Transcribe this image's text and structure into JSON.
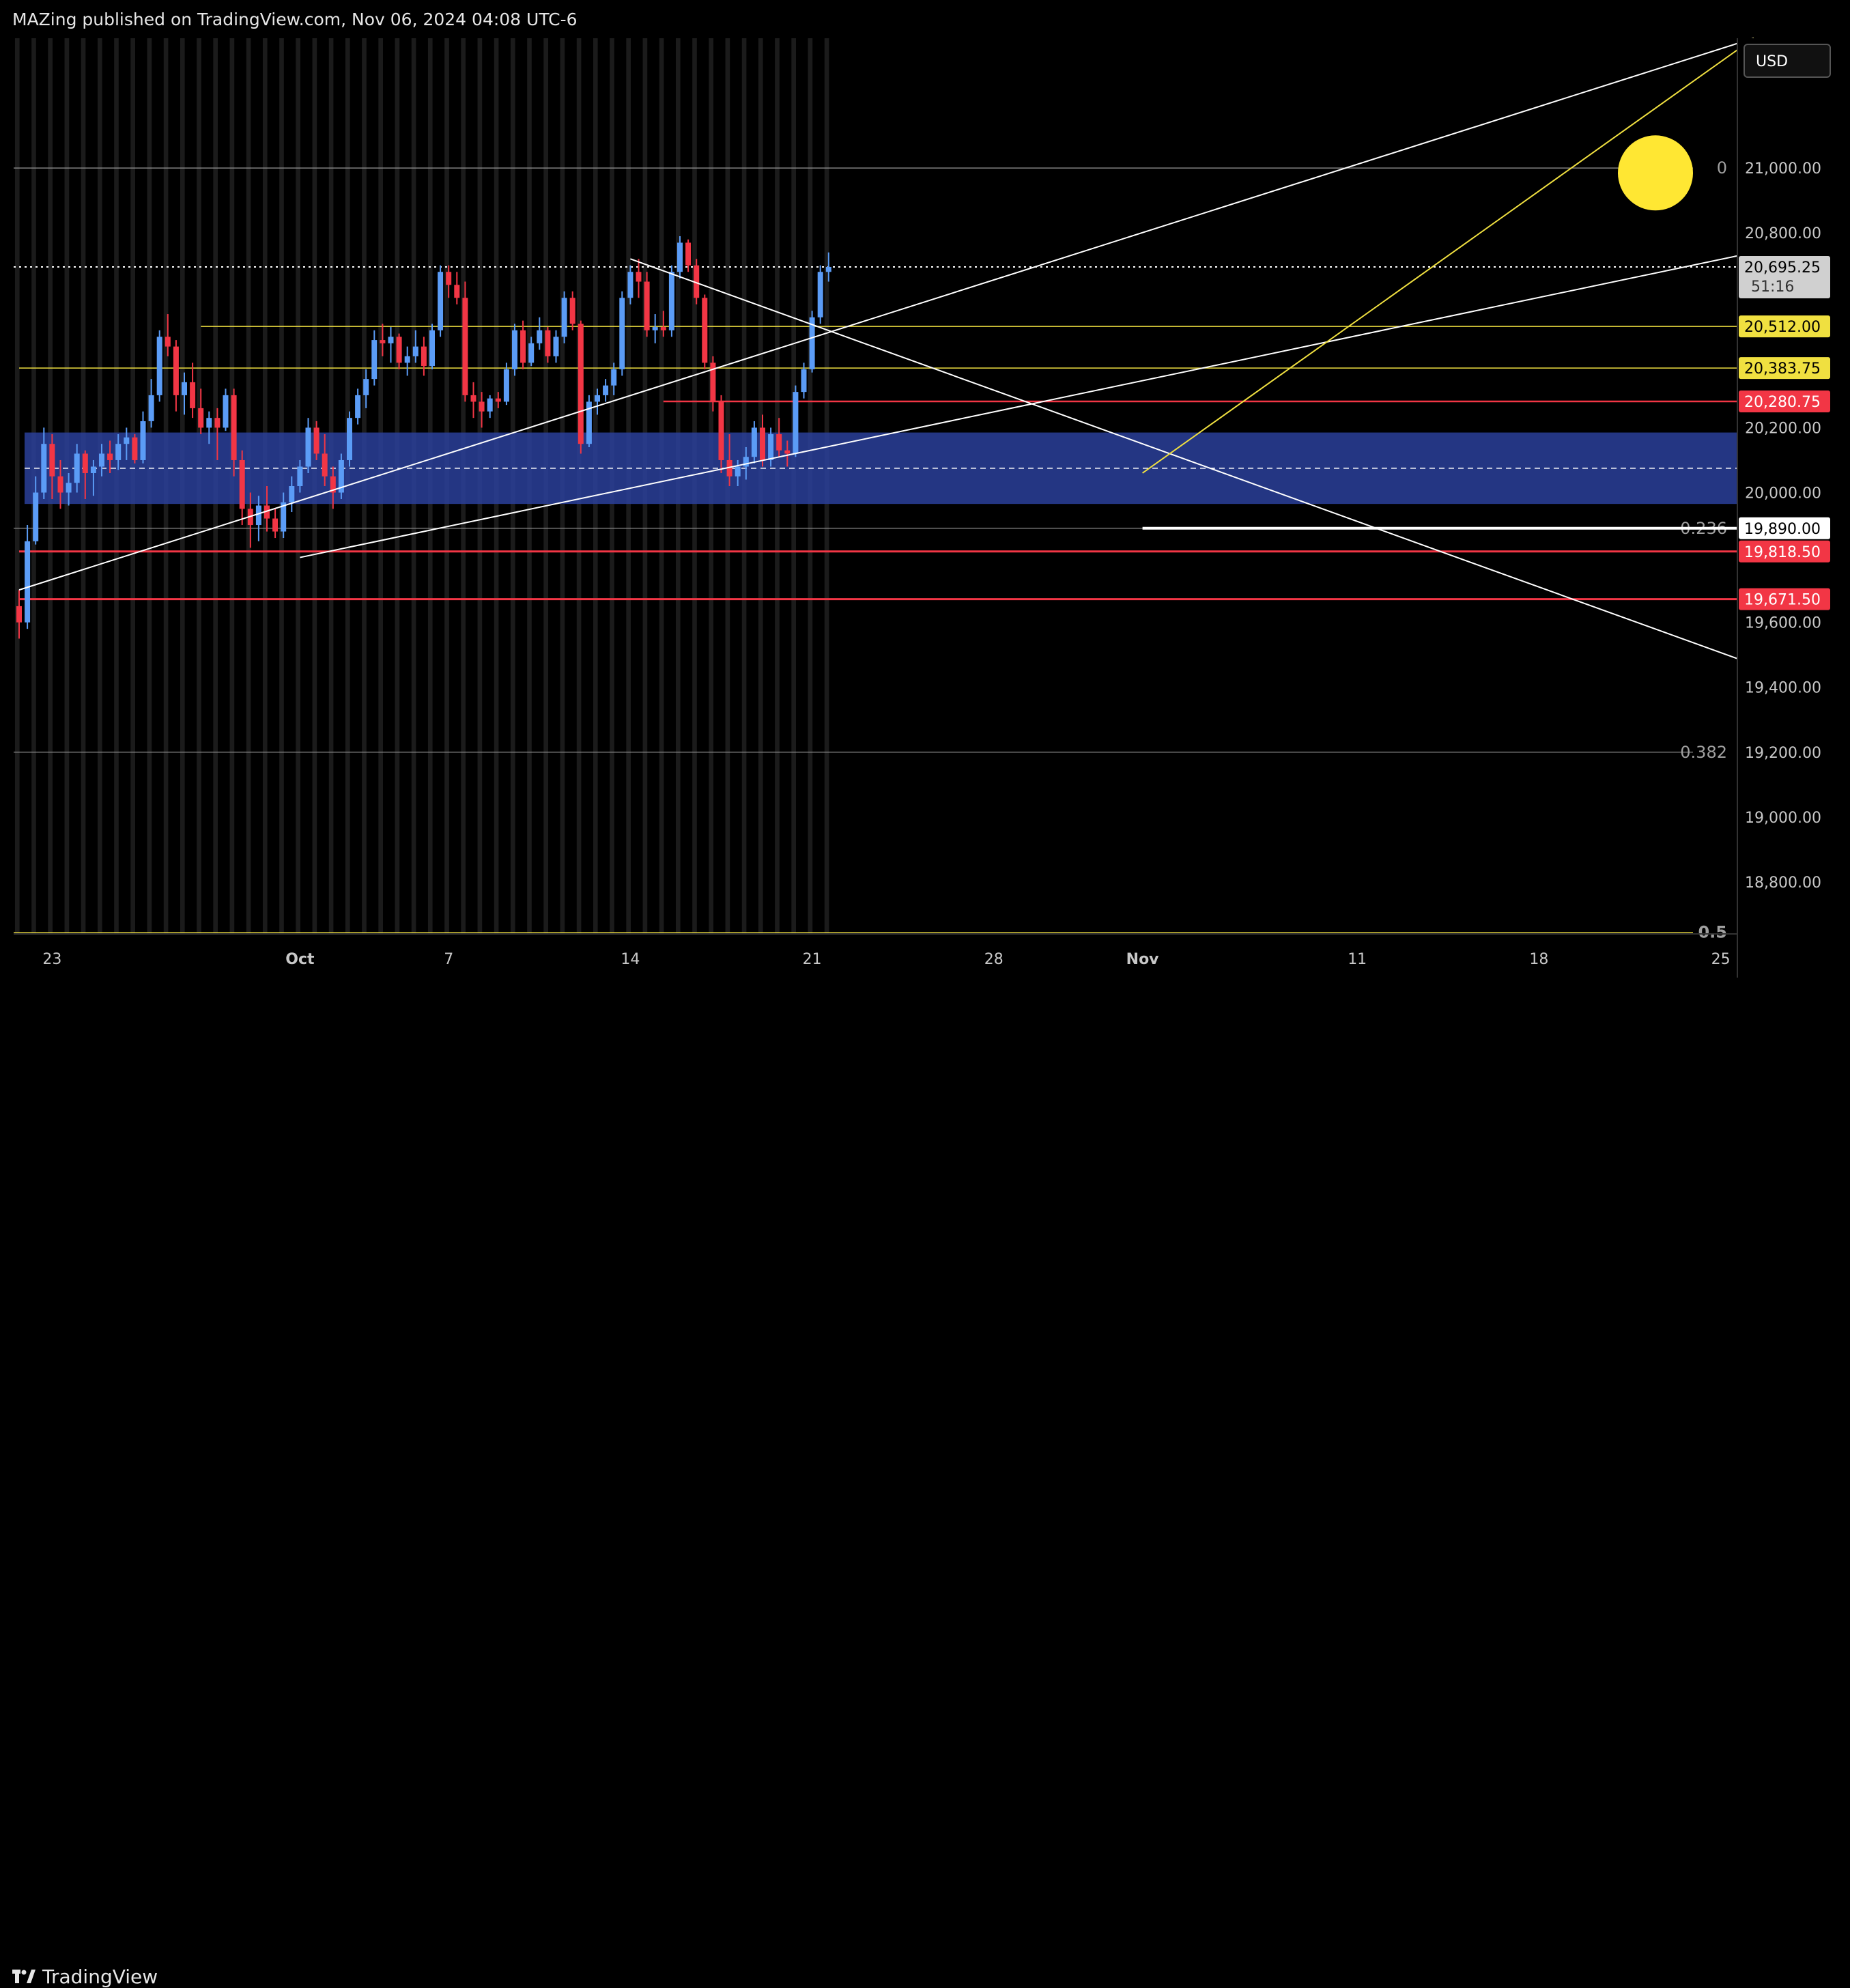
{
  "header": {
    "text": "MAZing published on TradingView.com, Nov 06, 2024 04:08 UTC-6"
  },
  "footer": {
    "brand": "TradingView"
  },
  "currency": "USD",
  "colors": {
    "bg": "#000000",
    "up": "#5b9cf6",
    "down": "#f23645",
    "yellow": "#f0e040",
    "white": "#ffffff",
    "zone": "#2a3f9a",
    "stripe": "#1b1b1b",
    "grid": "#333333"
  },
  "chart_data": {
    "type": "candlestick",
    "ylim": [
      18640,
      21400
    ],
    "y_ticks": [
      {
        "value": 21000,
        "label": "21,000.00"
      },
      {
        "value": 20800,
        "label": "20,800.00"
      },
      {
        "value": 20200,
        "label": "20,200.00"
      },
      {
        "value": 20000,
        "label": "20,000.00"
      },
      {
        "value": 19600,
        "label": "19,600.00"
      },
      {
        "value": 19400,
        "label": "19,400.00"
      },
      {
        "value": 19200,
        "label": "19,200.00"
      },
      {
        "value": 19000,
        "label": "19,000.00"
      },
      {
        "value": 18800,
        "label": "18,800.00"
      }
    ],
    "x_ticks": [
      {
        "label": "23",
        "bar": 4
      },
      {
        "label": "Oct",
        "bar": 34
      },
      {
        "label": "7",
        "bar": 52
      },
      {
        "label": "14",
        "bar": 74
      },
      {
        "label": "21",
        "bar": 96
      },
      {
        "label": "28",
        "bar": 118
      },
      {
        "label": "Nov",
        "bar": 136
      },
      {
        "label": "11",
        "bar": 162
      },
      {
        "label": "18",
        "bar": 184
      },
      {
        "label": "25",
        "bar": 206
      }
    ],
    "price_tags": [
      {
        "value": 20695.25,
        "label": "20,695.25",
        "sub": "51:16",
        "kind": "last"
      },
      {
        "value": 20512.0,
        "label": "20,512.00",
        "kind": "yellow"
      },
      {
        "value": 20383.75,
        "label": "20,383.75",
        "kind": "yellow"
      },
      {
        "value": 20280.75,
        "label": "20,280.75",
        "kind": "red"
      },
      {
        "value": 19890.0,
        "label": "19,890.00",
        "kind": "white"
      },
      {
        "value": 19818.5,
        "label": "19,818.50",
        "kind": "red"
      },
      {
        "value": 19671.5,
        "label": "19,671.50",
        "kind": "red"
      }
    ],
    "fib_levels": [
      {
        "value": 21000,
        "label": "0",
        "color": "#9a9a9a"
      },
      {
        "value": 19890,
        "label": "0.236",
        "color": "#9a9a9a"
      },
      {
        "value": 19200,
        "label": "0.382",
        "color": "#9a9a9a"
      },
      {
        "value": 18645,
        "label": "0.5",
        "color": "#f0e040"
      }
    ],
    "h_lines": [
      {
        "value": 20512.0,
        "color": "#f0e040",
        "from_bar": 22,
        "width": 1.5
      },
      {
        "value": 20383.75,
        "color": "#f0e040",
        "from_bar": 0,
        "width": 1.5
      },
      {
        "value": 20280.75,
        "color": "#f23645",
        "from_bar": 78,
        "width": 2.5
      },
      {
        "value": 19890.0,
        "color": "#ffffff",
        "from_bar": 136,
        "width": 4
      },
      {
        "value": 19818.5,
        "color": "#f23645",
        "from_bar": 0,
        "width": 3
      },
      {
        "value": 19671.5,
        "color": "#f23645",
        "from_bar": 0,
        "width": 3
      }
    ],
    "zone": {
      "top": 20185,
      "bottom": 19965,
      "mid": 20075
    },
    "trend_lines": [
      {
        "x1": 0,
        "y1": 19700,
        "x2": 210,
        "y2": 21400,
        "color": "#ffffff"
      },
      {
        "x1": 34,
        "y1": 19800,
        "x2": 210,
        "y2": 20740,
        "color": "#ffffff"
      },
      {
        "x1": 74,
        "y1": 20720,
        "x2": 210,
        "y2": 19470,
        "color": "#ffffff"
      },
      {
        "x1": 136,
        "y1": 20060,
        "x2": 210,
        "y2": 21400,
        "color": "#f0e040"
      }
    ],
    "candles": [
      [
        19650,
        19700,
        19550,
        19600
      ],
      [
        19600,
        19900,
        19580,
        19850
      ],
      [
        19850,
        20050,
        19840,
        20000
      ],
      [
        20000,
        20200,
        19980,
        20150
      ],
      [
        20150,
        20180,
        19980,
        20050
      ],
      [
        20050,
        20100,
        19950,
        20000
      ],
      [
        20000,
        20060,
        19960,
        20030
      ],
      [
        20030,
        20150,
        20000,
        20120
      ],
      [
        20120,
        20130,
        19980,
        20060
      ],
      [
        20060,
        20100,
        19990,
        20080
      ],
      [
        20080,
        20150,
        20050,
        20120
      ],
      [
        20120,
        20160,
        20060,
        20100
      ],
      [
        20100,
        20180,
        20070,
        20150
      ],
      [
        20150,
        20200,
        20100,
        20170
      ],
      [
        20170,
        20180,
        20090,
        20100
      ],
      [
        20100,
        20250,
        20090,
        20220
      ],
      [
        20220,
        20350,
        20200,
        20300
      ],
      [
        20300,
        20500,
        20280,
        20480
      ],
      [
        20480,
        20550,
        20420,
        20450
      ],
      [
        20450,
        20470,
        20250,
        20300
      ],
      [
        20300,
        20370,
        20240,
        20340
      ],
      [
        20340,
        20400,
        20230,
        20260
      ],
      [
        20260,
        20320,
        20180,
        20200
      ],
      [
        20200,
        20250,
        20150,
        20230
      ],
      [
        20230,
        20260,
        20100,
        20200
      ],
      [
        20200,
        20320,
        20190,
        20300
      ],
      [
        20300,
        20320,
        20050,
        20100
      ],
      [
        20100,
        20130,
        19900,
        19950
      ],
      [
        19950,
        20000,
        19830,
        19900
      ],
      [
        19900,
        19990,
        19850,
        19960
      ],
      [
        19960,
        20020,
        19880,
        19920
      ],
      [
        19920,
        19950,
        19860,
        19880
      ],
      [
        19880,
        20000,
        19860,
        19970
      ],
      [
        19970,
        20050,
        19940,
        20020
      ],
      [
        20020,
        20100,
        20000,
        20080
      ],
      [
        20080,
        20230,
        20060,
        20200
      ],
      [
        20200,
        20220,
        20100,
        20120
      ],
      [
        20120,
        20180,
        20020,
        20050
      ],
      [
        20050,
        20080,
        19950,
        20000
      ],
      [
        20000,
        20120,
        19980,
        20100
      ],
      [
        20100,
        20250,
        20080,
        20230
      ],
      [
        20230,
        20320,
        20210,
        20300
      ],
      [
        20300,
        20380,
        20260,
        20350
      ],
      [
        20350,
        20500,
        20330,
        20470
      ],
      [
        20470,
        20520,
        20420,
        20460
      ],
      [
        20460,
        20510,
        20400,
        20480
      ],
      [
        20480,
        20490,
        20380,
        20400
      ],
      [
        20400,
        20450,
        20360,
        20420
      ],
      [
        20420,
        20500,
        20400,
        20450
      ],
      [
        20450,
        20480,
        20360,
        20390
      ],
      [
        20390,
        20520,
        20380,
        20500
      ],
      [
        20500,
        20700,
        20480,
        20680
      ],
      [
        20680,
        20700,
        20600,
        20640
      ],
      [
        20640,
        20680,
        20580,
        20600
      ],
      [
        20600,
        20650,
        20280,
        20300
      ],
      [
        20300,
        20340,
        20230,
        20280
      ],
      [
        20280,
        20310,
        20200,
        20250
      ],
      [
        20250,
        20300,
        20230,
        20290
      ],
      [
        20290,
        20310,
        20260,
        20280
      ],
      [
        20280,
        20400,
        20270,
        20380
      ],
      [
        20380,
        20520,
        20360,
        20500
      ],
      [
        20500,
        20530,
        20380,
        20400
      ],
      [
        20400,
        20480,
        20390,
        20460
      ],
      [
        20460,
        20540,
        20440,
        20500
      ],
      [
        20500,
        20510,
        20400,
        20420
      ],
      [
        20420,
        20500,
        20400,
        20480
      ],
      [
        20480,
        20620,
        20460,
        20600
      ],
      [
        20600,
        20620,
        20500,
        20520
      ],
      [
        20520,
        20530,
        20120,
        20150
      ],
      [
        20150,
        20300,
        20140,
        20280
      ],
      [
        20280,
        20320,
        20240,
        20300
      ],
      [
        20300,
        20350,
        20280,
        20330
      ],
      [
        20330,
        20400,
        20300,
        20380
      ],
      [
        20380,
        20620,
        20360,
        20600
      ],
      [
        20600,
        20700,
        20580,
        20680
      ],
      [
        20680,
        20720,
        20600,
        20650
      ],
      [
        20650,
        20680,
        20480,
        20500
      ],
      [
        20500,
        20550,
        20460,
        20510
      ],
      [
        20510,
        20560,
        20480,
        20500
      ],
      [
        20500,
        20700,
        20480,
        20680
      ],
      [
        20680,
        20790,
        20660,
        20770
      ],
      [
        20770,
        20780,
        20680,
        20700
      ],
      [
        20700,
        20720,
        20580,
        20600
      ],
      [
        20600,
        20610,
        20380,
        20400
      ],
      [
        20400,
        20420,
        20250,
        20280
      ],
      [
        20280,
        20300,
        20060,
        20100
      ],
      [
        20100,
        20180,
        20020,
        20050
      ],
      [
        20050,
        20100,
        20020,
        20080
      ],
      [
        20080,
        20140,
        20040,
        20110
      ],
      [
        20110,
        20220,
        20090,
        20200
      ],
      [
        20200,
        20240,
        20080,
        20100
      ],
      [
        20100,
        20200,
        20080,
        20180
      ],
      [
        20180,
        20230,
        20110,
        20130
      ],
      [
        20130,
        20160,
        20080,
        20120
      ],
      [
        20120,
        20330,
        20110,
        20310
      ],
      [
        20310,
        20400,
        20290,
        20380
      ],
      [
        20380,
        20560,
        20370,
        20540
      ],
      [
        20540,
        20700,
        20520,
        20680
      ],
      [
        20680,
        20740,
        20650,
        20695.25
      ]
    ]
  }
}
